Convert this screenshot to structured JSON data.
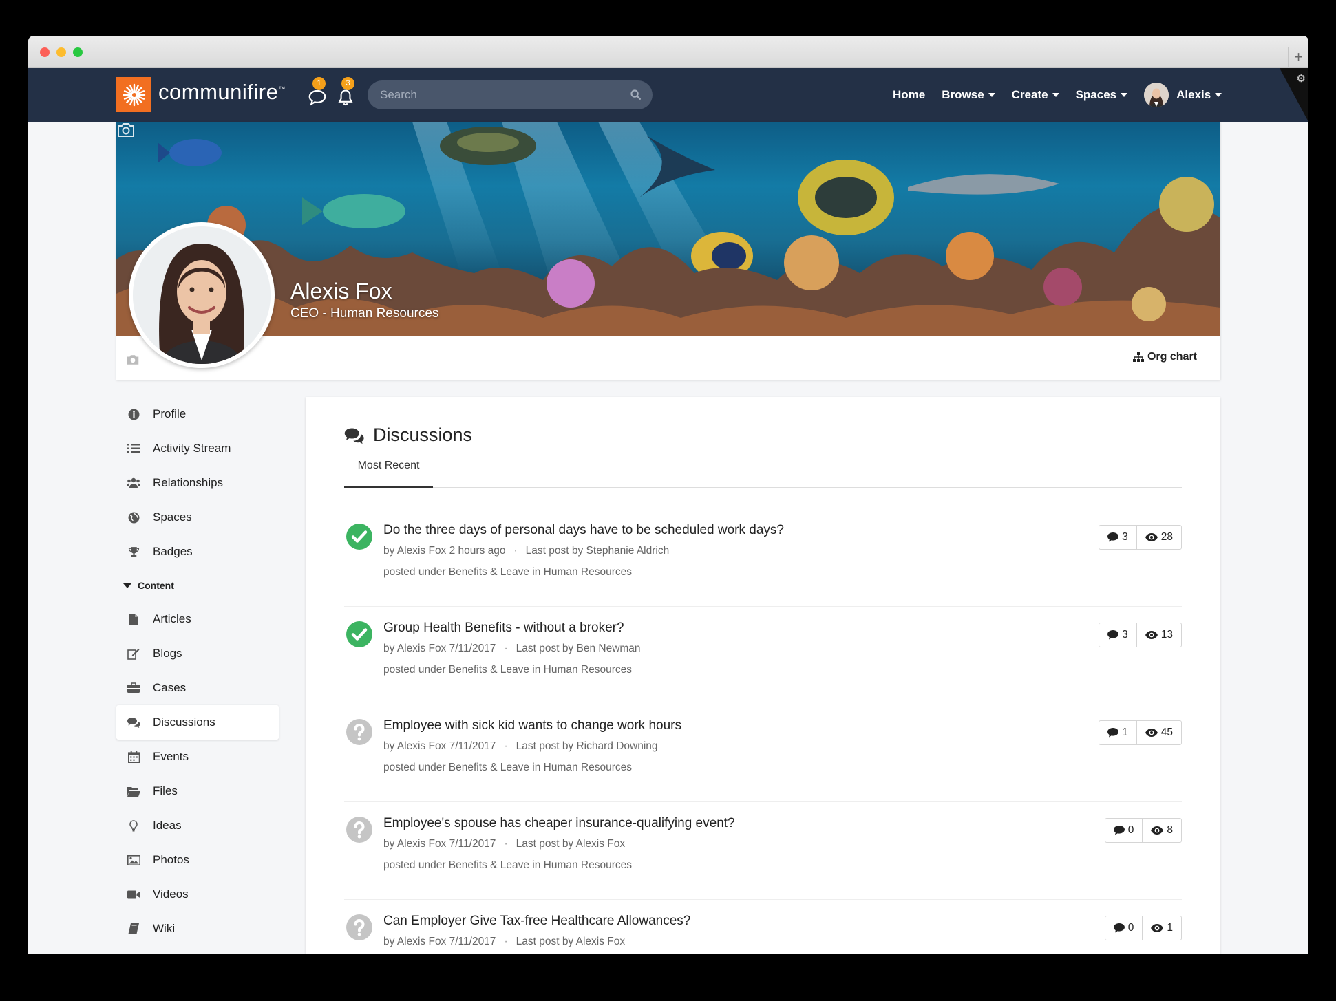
{
  "app": {
    "logo_text": "communifire",
    "logo_tm": "™"
  },
  "colors": {
    "nav_bg": "#233046",
    "brand_orange": "#f26f21",
    "badge": "#f5a01a",
    "resolved_green": "#3cb461",
    "unanswered_gray": "#c5c5c5"
  },
  "header": {
    "messages_badge": "1",
    "notifications_badge": "3",
    "search_placeholder": "Search",
    "nav": [
      {
        "label": "Home"
      },
      {
        "label": "Browse"
      },
      {
        "label": "Create"
      },
      {
        "label": "Spaces"
      }
    ],
    "user_label": "Alexis"
  },
  "profile": {
    "name": "Alexis Fox",
    "title": "CEO - Human Resources",
    "org_chart_label": "Org chart"
  },
  "sidebar": {
    "items_top": [
      {
        "label": "Profile",
        "icon": "info-icon"
      },
      {
        "label": "Activity Stream",
        "icon": "list-icon"
      },
      {
        "label": "Relationships",
        "icon": "users-icon"
      },
      {
        "label": "Spaces",
        "icon": "globe-icon"
      },
      {
        "label": "Badges",
        "icon": "trophy-icon"
      }
    ],
    "content_heading": "Content",
    "items_content": [
      {
        "label": "Articles",
        "icon": "file-icon"
      },
      {
        "label": "Blogs",
        "icon": "blog-icon"
      },
      {
        "label": "Cases",
        "icon": "briefcase-icon"
      },
      {
        "label": "Discussions",
        "icon": "comments-icon",
        "active": true
      },
      {
        "label": "Events",
        "icon": "calendar-icon"
      },
      {
        "label": "Files",
        "icon": "folder-icon"
      },
      {
        "label": "Ideas",
        "icon": "lightbulb-icon"
      },
      {
        "label": "Photos",
        "icon": "image-icon"
      },
      {
        "label": "Videos",
        "icon": "video-icon"
      },
      {
        "label": "Wiki",
        "icon": "book-icon"
      }
    ]
  },
  "main": {
    "title": "Discussions",
    "tab_label": "Most Recent",
    "threads": [
      {
        "title": "Do the three days of personal days have to be scheduled work days?",
        "by": "by Alexis Fox 2 hours ago",
        "last_post": "Last post by Stephanie Aldrich",
        "posted_under": "posted under Benefits & Leave in Human Resources",
        "replies": "3",
        "views": "28",
        "status": "answered"
      },
      {
        "title": "Group Health Benefits - without a broker?",
        "by": "by Alexis Fox 7/11/2017",
        "last_post": "Last post by Ben Newman",
        "posted_under": "posted under Benefits & Leave in Human Resources",
        "replies": "3",
        "views": "13",
        "status": "answered"
      },
      {
        "title": "Employee with sick kid wants to change work hours",
        "by": "by Alexis Fox 7/11/2017",
        "last_post": "Last post by Richard Downing",
        "posted_under": "posted under Benefits & Leave in Human Resources",
        "replies": "1",
        "views": "45",
        "status": "question"
      },
      {
        "title": "Employee's spouse has cheaper insurance-qualifying event?",
        "by": "by Alexis Fox 7/11/2017",
        "last_post": "Last post by Alexis Fox",
        "posted_under": "posted under Benefits & Leave in Human Resources",
        "replies": "0",
        "views": "8",
        "status": "question"
      },
      {
        "title": "Can Employer Give Tax-free Healthcare Allowances?",
        "by": "by Alexis Fox 7/11/2017",
        "last_post": "Last post by Alexis Fox",
        "posted_under": "",
        "replies": "0",
        "views": "1",
        "status": "question"
      }
    ]
  }
}
